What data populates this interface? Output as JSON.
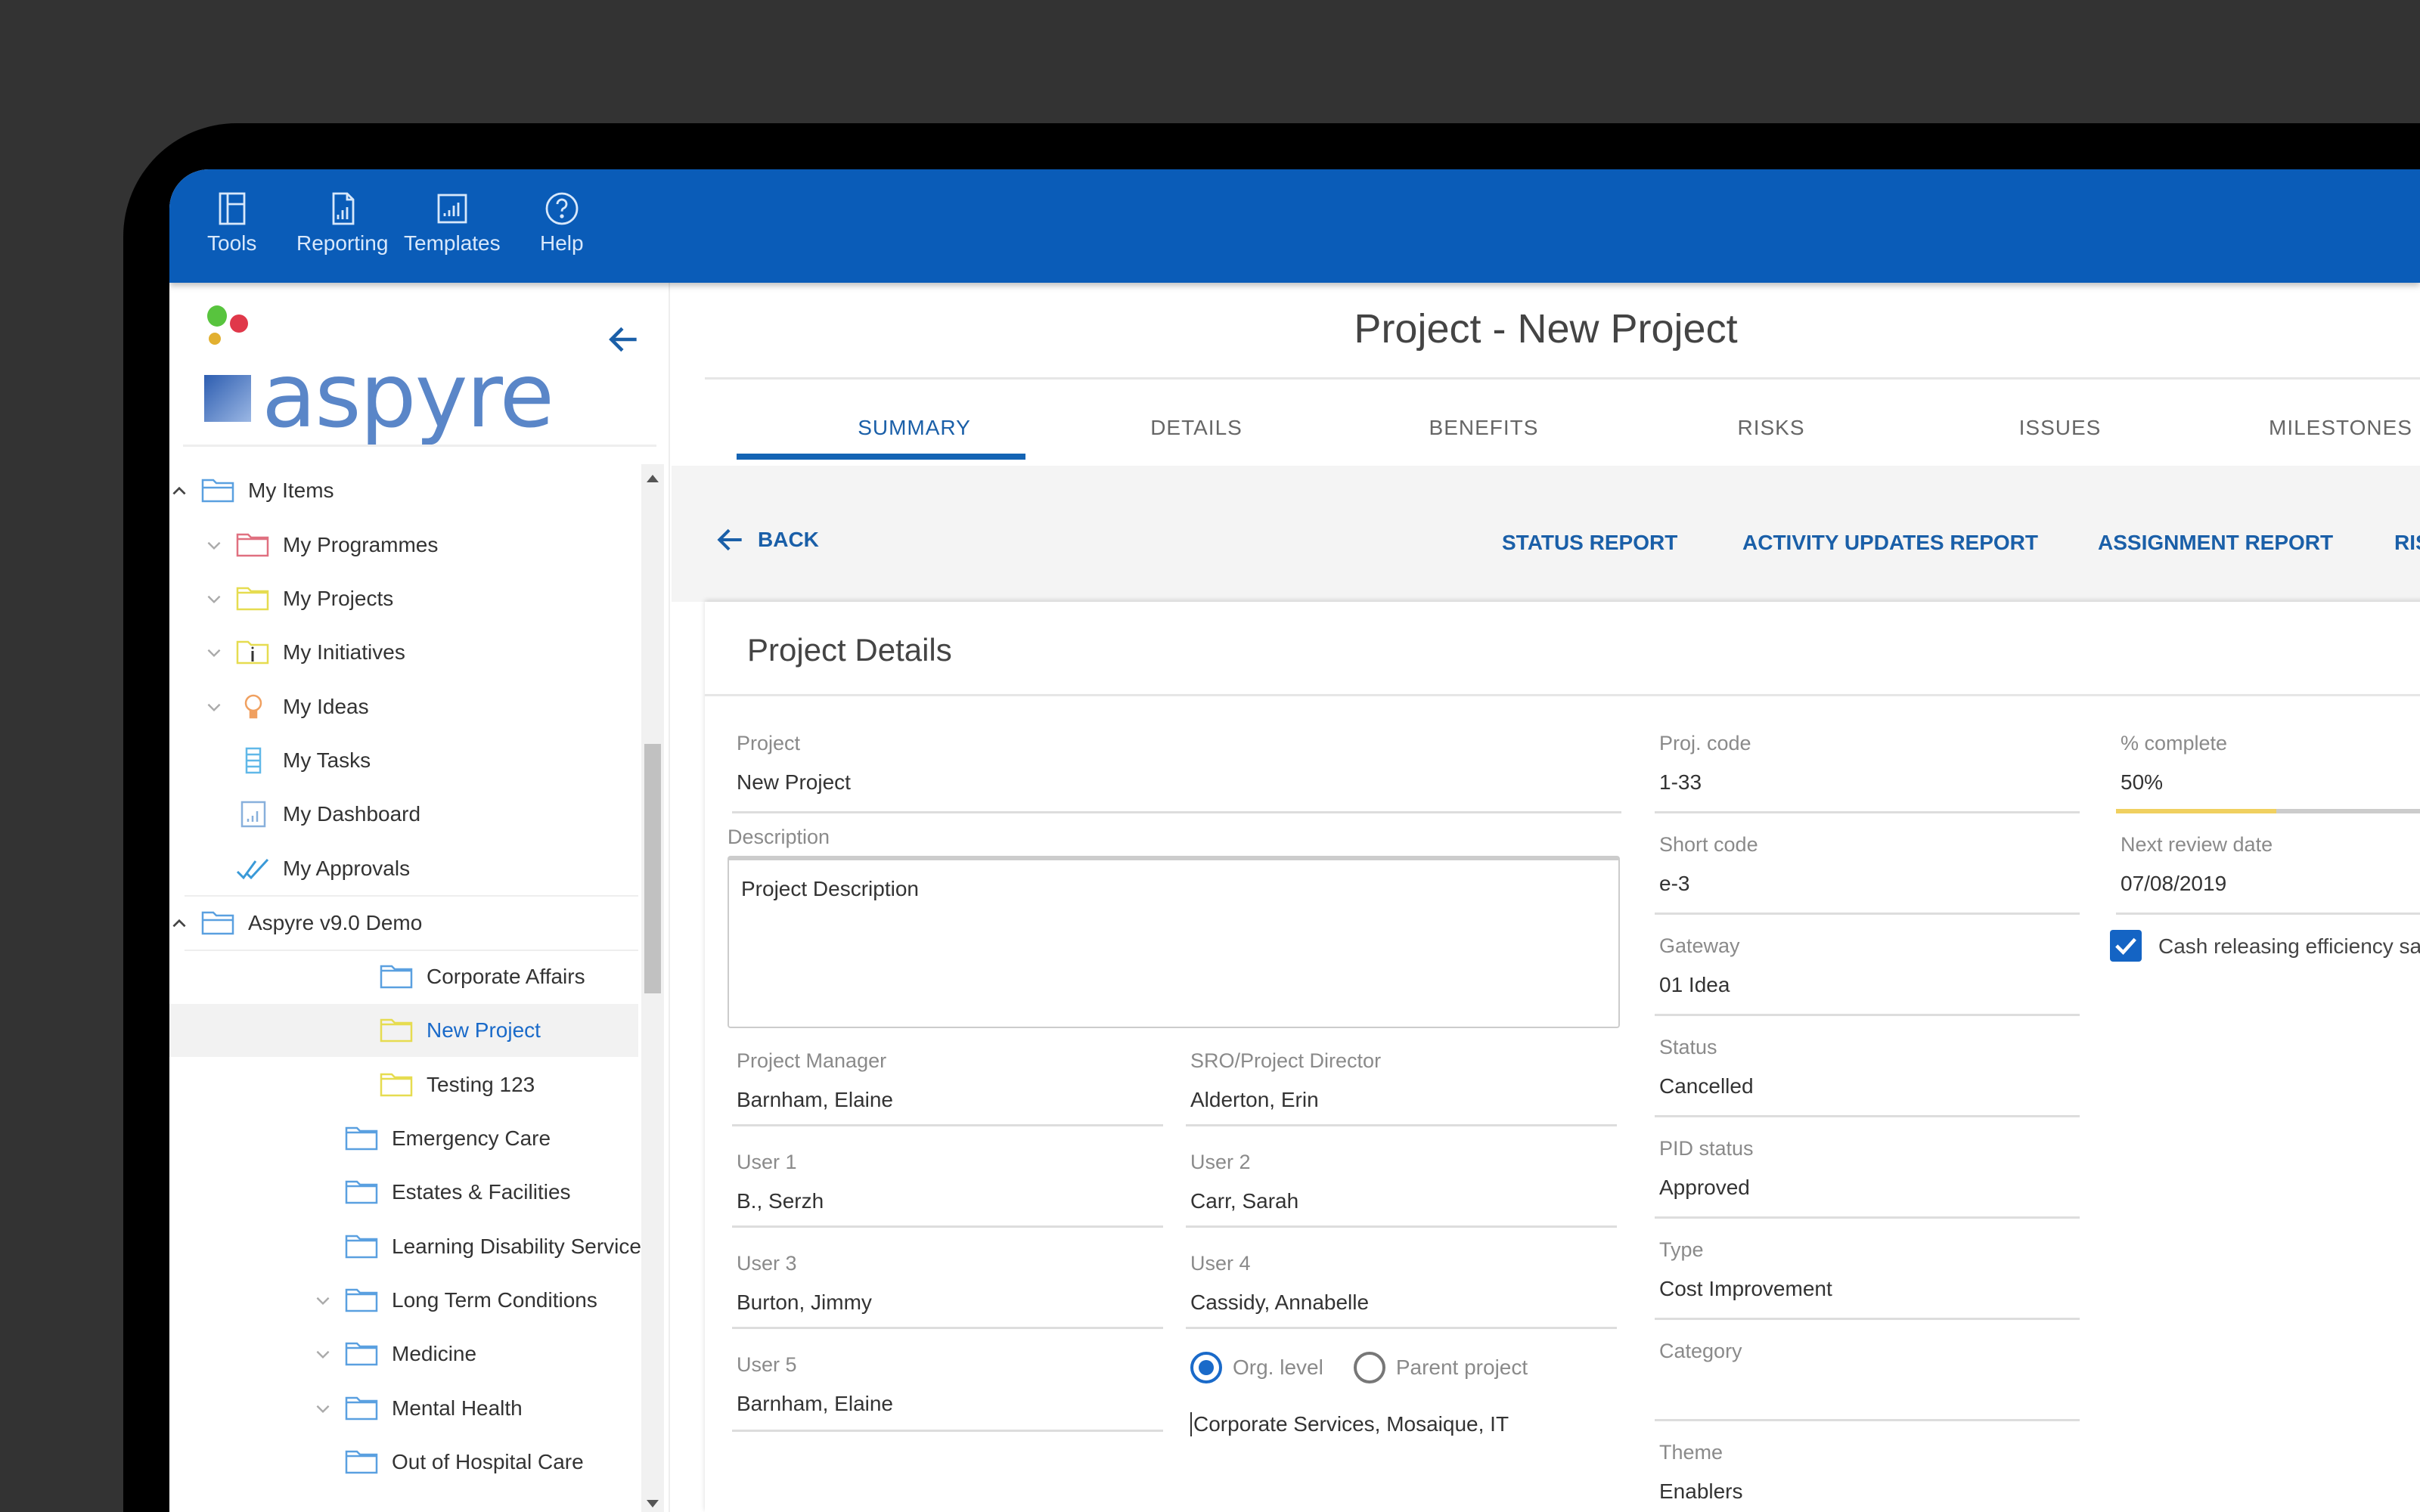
{
  "toolbar": {
    "items": [
      {
        "label": "Tools",
        "icon": "layout-icon"
      },
      {
        "label": "Reporting",
        "icon": "report-document-icon"
      },
      {
        "label": "Templates",
        "icon": "chart-template-icon"
      },
      {
        "label": "Help",
        "icon": "help-circle-icon"
      }
    ]
  },
  "sidebar": {
    "logo_text": "aspyre",
    "tree": [
      {
        "label": "My Items",
        "level": 0,
        "expander": "up",
        "icon": "folder-open-blue"
      },
      {
        "label": "My Programmes",
        "level": 1,
        "expander": "down",
        "icon": "folder-red"
      },
      {
        "label": "My Projects",
        "level": 1,
        "expander": "down",
        "icon": "folder-yellow"
      },
      {
        "label": "My Initiatives",
        "level": 1,
        "expander": "down",
        "icon": "folder-info-yellow"
      },
      {
        "label": "My Ideas",
        "level": 1,
        "expander": "down",
        "icon": "lightbulb"
      },
      {
        "label": "My Tasks",
        "level": 1,
        "expander": "none",
        "icon": "tasks"
      },
      {
        "label": "My Dashboard",
        "level": 1,
        "expander": "none",
        "icon": "dashboard"
      },
      {
        "label": "My Approvals",
        "level": 1,
        "expander": "none",
        "icon": "approvals"
      },
      {
        "label": "Aspyre v9.0 Demo",
        "level": 0,
        "expander": "up",
        "icon": "folder-open-blue"
      },
      {
        "label": "Corporate Affairs",
        "level": 3,
        "expander": "none",
        "icon": "folder-blue"
      },
      {
        "label": "New Project",
        "level": 3,
        "expander": "none",
        "icon": "folder-yellow",
        "selected": true
      },
      {
        "label": "Testing 123",
        "level": 3,
        "expander": "none",
        "icon": "folder-yellow"
      },
      {
        "label": "Emergency Care",
        "level": 2,
        "expander": "none",
        "icon": "folder-blue"
      },
      {
        "label": "Estates & Facilities",
        "level": 2,
        "expander": "none",
        "icon": "folder-blue"
      },
      {
        "label": "Learning Disability Services",
        "level": 2,
        "expander": "none",
        "icon": "folder-blue"
      },
      {
        "label": "Long Term Conditions",
        "level": 2,
        "expander": "down",
        "icon": "folder-blue"
      },
      {
        "label": "Medicine",
        "level": 2,
        "expander": "down",
        "icon": "folder-blue"
      },
      {
        "label": "Mental Health",
        "level": 2,
        "expander": "down",
        "icon": "folder-blue"
      },
      {
        "label": "Out of Hospital Care",
        "level": 2,
        "expander": "none",
        "icon": "folder-blue"
      }
    ]
  },
  "main": {
    "title": "Project - New Project",
    "tabs": [
      "SUMMARY",
      "DETAILS",
      "BENEFITS",
      "RISKS",
      "ISSUES",
      "MILESTONES"
    ],
    "active_tab": 0,
    "back_label": "BACK",
    "reports": [
      "STATUS REPORT",
      "ACTIVITY UPDATES REPORT",
      "ASSIGNMENT REPORT",
      "RISK REPORT"
    ],
    "card_title": "Project Details",
    "fields": {
      "project": {
        "label": "Project",
        "value": "New Project"
      },
      "description": {
        "label": "Description",
        "value": "Project Description"
      },
      "project_manager": {
        "label": "Project Manager",
        "value": "Barnham, Elaine"
      },
      "sro": {
        "label": "SRO/Project Director",
        "value": "Alderton, Erin"
      },
      "user1": {
        "label": "User 1",
        "value": "B., Serzh"
      },
      "user2": {
        "label": "User 2",
        "value": "Carr, Sarah"
      },
      "user3": {
        "label": "User 3",
        "value": "Burton, Jimmy"
      },
      "user4": {
        "label": "User 4",
        "value": "Cassidy, Annabelle"
      },
      "user5": {
        "label": "User 5",
        "value": "Barnham, Elaine"
      },
      "org_level_label": "Org. level",
      "parent_project_label": "Parent project",
      "org_value": "Corporate Services, Mosaique, IT",
      "proj_code": {
        "label": "Proj. code",
        "value": "1-33"
      },
      "short_code": {
        "label": "Short code",
        "value": "e-3"
      },
      "gateway": {
        "label": "Gateway",
        "value": "01 Idea"
      },
      "status": {
        "label": "Status",
        "value": "Cancelled"
      },
      "pid_status": {
        "label": "PID status",
        "value": "Approved"
      },
      "type": {
        "label": "Type",
        "value": "Cost Improvement"
      },
      "category": {
        "label": "Category",
        "value": ""
      },
      "theme": {
        "label": "Theme",
        "value": "Enablers"
      },
      "percent_complete": {
        "label": "% complete",
        "value": "50%",
        "fraction": 0.5
      },
      "next_review": {
        "label": "Next review date",
        "value": "07/08/2019"
      },
      "cash_releasing": {
        "label": "Cash releasing efficiency savings",
        "checked": true
      }
    }
  },
  "colors": {
    "brand_blue": "#0a5cb8",
    "link_blue": "#1a5fa8",
    "progress_yellow": "#f0d060"
  }
}
